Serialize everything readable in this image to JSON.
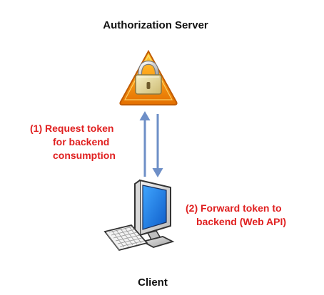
{
  "diagram": {
    "server_label": "Authorization Server",
    "client_label": "Client",
    "request_note": {
      "line1": "(1)  Request token",
      "line2": "for backend",
      "line3": "consumption"
    },
    "forward_note": {
      "line1": "(2) Forward token to",
      "line2": "backend (Web API)"
    },
    "colors": {
      "note_text": "#e02020",
      "arrow": "#6e8fc7",
      "warning_orange": "#f18a00",
      "screen_blue": "#1d74dd"
    },
    "icons": {
      "server": "warning-lock-icon",
      "client": "computer-icon"
    }
  }
}
